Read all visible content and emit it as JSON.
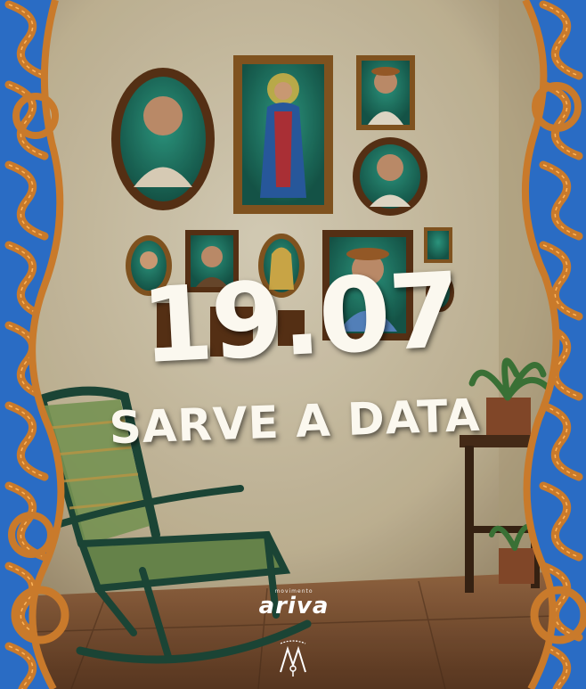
{
  "headline": {
    "date": "19.07",
    "subtitle": "SARVE A DATA"
  },
  "brand": {
    "small_text": "movimento",
    "name": "ariva"
  },
  "colors": {
    "wall": "#d8cdb4",
    "border_blue": "#2a6cc4",
    "border_orange": "#c97a2b",
    "text": "#fbf8ef",
    "frame_gold": "#8a5a22",
    "portrait_bg": "#1f7f6d"
  },
  "icons": [
    "rocking-chair",
    "potted-plant",
    "side-table",
    "brand-emblem-icon"
  ]
}
